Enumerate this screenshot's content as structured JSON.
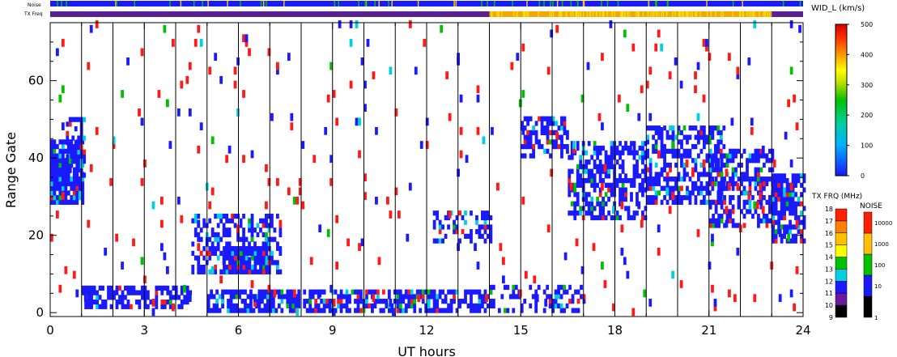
{
  "chart_data": {
    "type": "heatmap",
    "xlabel": "UT hours",
    "ylabel": "Range Gate",
    "xlim": [
      0,
      24
    ],
    "ylim": [
      -1,
      75
    ],
    "x_ticks": [
      "0",
      "3",
      "6",
      "9",
      "12",
      "15",
      "18",
      "21",
      "24"
    ],
    "y_ticks": [
      "0",
      "20",
      "40",
      "60"
    ],
    "vertical_lines_at_hours": [
      1,
      2,
      3,
      4,
      5,
      6,
      7,
      8,
      9,
      10,
      11,
      12,
      13,
      14,
      15,
      16,
      17,
      18,
      19,
      20,
      21,
      22,
      23
    ],
    "top_bars": {
      "noise_label": "Noise",
      "txfreq_label": "TX Freq",
      "txfreq_segments": [
        {
          "start": 0,
          "end": 14,
          "color": "#5a2290"
        },
        {
          "start": 14,
          "end": 23,
          "color": "#f2a800"
        },
        {
          "start": 23,
          "end": 24,
          "color": "#5a2290"
        }
      ],
      "noise_color": "#1a1aff"
    },
    "colorbar_width": {
      "title": "WID_L (km/s)",
      "ticks": [
        "0",
        "100",
        "200",
        "300",
        "400",
        "500"
      ],
      "range": [
        0,
        500
      ]
    },
    "colorbar_txfreq": {
      "title": "TX FRQ (MHz)",
      "ticks": [
        "9",
        "10",
        "11",
        "12",
        "13",
        "14",
        "15",
        "16",
        "17",
        "18"
      ],
      "colors": [
        "#000000",
        "#6a1aa0",
        "#1a1aff",
        "#00d0e0",
        "#00c000",
        "#ffff00",
        "#ffc000",
        "#ff8000",
        "#ff2000"
      ]
    },
    "colorbar_noise": {
      "title": "NOISE",
      "ticks": [
        "1",
        "10",
        "100",
        "1000",
        "10000"
      ],
      "colors": [
        "#000000",
        "#1a1aff",
        "#00c000",
        "#ffc000",
        "#ff2000"
      ]
    },
    "scatter_blocks": [
      {
        "h0": 0.0,
        "h1": 1.0,
        "g0": 28,
        "g1": 44,
        "density": 0.85
      },
      {
        "h0": 0.5,
        "h1": 1.1,
        "g0": 35,
        "g1": 50,
        "density": 0.55
      },
      {
        "h0": 1.0,
        "h1": 4.5,
        "g0": 1,
        "g1": 7,
        "density": 0.6
      },
      {
        "h0": 4.5,
        "h1": 7.3,
        "g0": 10,
        "g1": 25,
        "density": 0.45
      },
      {
        "h0": 5.5,
        "h1": 7.0,
        "g0": 10,
        "g1": 17,
        "density": 0.8
      },
      {
        "h0": 5.0,
        "h1": 14.0,
        "g0": 0,
        "g1": 6,
        "density": 0.7
      },
      {
        "h0": 12.2,
        "h1": 14.0,
        "g0": 18,
        "g1": 26,
        "density": 0.45
      },
      {
        "h0": 14.0,
        "h1": 17.0,
        "g0": 0,
        "g1": 7,
        "density": 0.35
      },
      {
        "h0": 15.0,
        "h1": 16.5,
        "g0": 40,
        "g1": 50,
        "density": 0.55
      },
      {
        "h0": 16.5,
        "h1": 19.0,
        "g0": 24,
        "g1": 44,
        "density": 0.55
      },
      {
        "h0": 19.0,
        "h1": 21.5,
        "g0": 28,
        "g1": 48,
        "density": 0.55
      },
      {
        "h0": 21.0,
        "h1": 23.0,
        "g0": 22,
        "g1": 42,
        "density": 0.5
      },
      {
        "h0": 23.0,
        "h1": 24.0,
        "g0": 18,
        "g1": 35,
        "density": 0.7
      },
      {
        "h0": 0.0,
        "h1": 24.0,
        "g0": 0,
        "g1": 75,
        "density": 0.018
      }
    ]
  }
}
